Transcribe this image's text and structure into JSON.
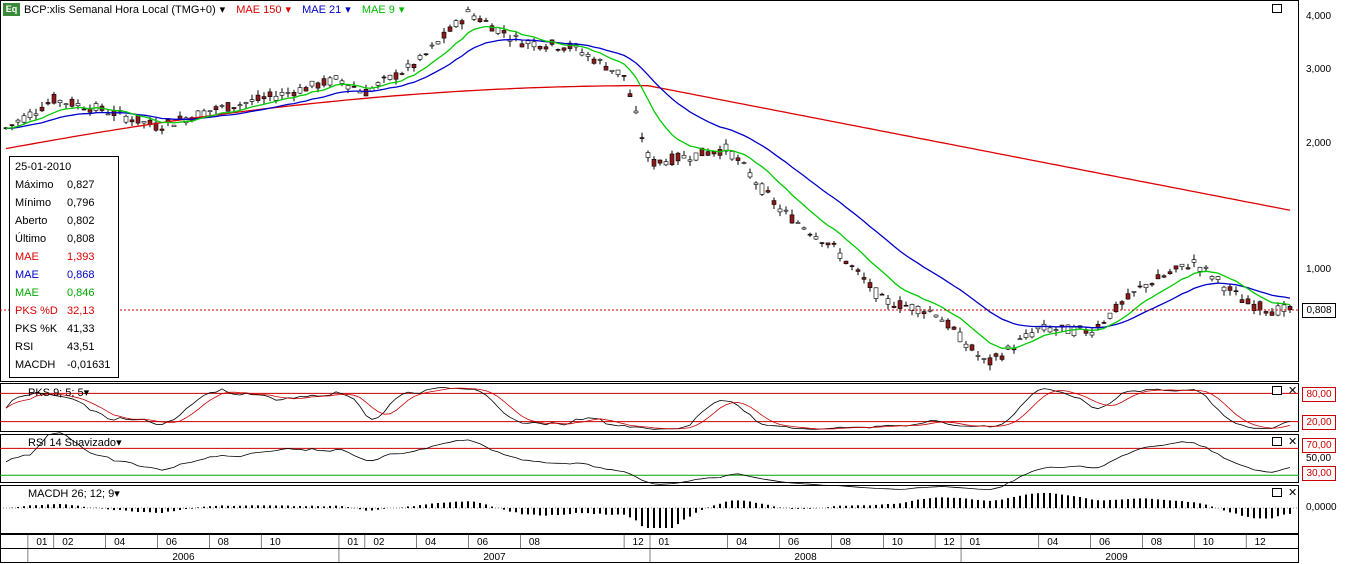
{
  "header": {
    "logo": "Eq",
    "symbol": "BCP:xlis Semanal Hora Local (TMG+0)",
    "mae150": "MAE 150",
    "mae21": "MAE 21",
    "mae9": "MAE 9",
    "dropdown_glyph": "▾"
  },
  "infobox": {
    "date": "25-01-2010",
    "rows": [
      {
        "label": "Máximo",
        "value": "0,827",
        "color": "#000000"
      },
      {
        "label": "Mínimo",
        "value": "0,796",
        "color": "#000000"
      },
      {
        "label": "Aberto",
        "value": "0,802",
        "color": "#000000"
      },
      {
        "label": "Último",
        "value": "0,808",
        "color": "#000000"
      },
      {
        "label": "MAE",
        "value": "1,393",
        "color": "#dd0000"
      },
      {
        "label": "MAE",
        "value": "0,868",
        "color": "#0000cc"
      },
      {
        "label": "MAE",
        "value": "0,846",
        "color": "#00aa00"
      },
      {
        "label": "PKS %D",
        "value": "32,13",
        "color": "#dd0000"
      },
      {
        "label": "PKS %K",
        "value": "41,33",
        "color": "#000000"
      },
      {
        "label": "RSI",
        "value": "43,51",
        "color": "#000000"
      },
      {
        "label": "MACDH",
        "value": "-0,01631",
        "color": "#000000"
      }
    ]
  },
  "panels": {
    "pks_title": "PKS 9; 5; 5",
    "rsi_title": "RSI 14 Suavizado",
    "macd_title": "MACDH 26; 12; 9"
  },
  "axis": {
    "price_labels": [
      "4,000",
      "3,000",
      "2,000",
      "1,000"
    ],
    "last_price": "0,808",
    "pks_levels": [
      "80,00",
      "20,00"
    ],
    "rsi_levels": [
      "70,00",
      "50,00",
      "30,00"
    ],
    "macd_zero": "0,0000",
    "months": [
      "01",
      "02",
      "04",
      "06",
      "08",
      "10",
      "01",
      "02",
      "04",
      "06",
      "08",
      "12",
      "01",
      "04",
      "06",
      "08",
      "10",
      "12",
      "01",
      "04",
      "06",
      "08",
      "10",
      "12"
    ],
    "years": [
      "2006",
      "2007",
      "2008",
      "2009"
    ]
  },
  "chart_data": {
    "type": "candlestick",
    "title": "BCP:xlis Semanal Hora Local (TMG+0)",
    "scale": "log",
    "ylim": [
      0.5,
      4.2
    ],
    "last": 0.808,
    "x_range": [
      "2005-12",
      "2010-01"
    ],
    "approx_close_path": [
      {
        "date": "2005-12",
        "close": 2.15
      },
      {
        "date": "2006-02",
        "close": 2.55
      },
      {
        "date": "2006-04",
        "close": 2.4
      },
      {
        "date": "2006-06",
        "close": 2.2
      },
      {
        "date": "2006-08",
        "close": 2.4
      },
      {
        "date": "2006-10",
        "close": 2.55
      },
      {
        "date": "2007-01",
        "close": 2.85
      },
      {
        "date": "2007-02",
        "close": 2.65
      },
      {
        "date": "2007-04",
        "close": 3.1
      },
      {
        "date": "2007-06",
        "close": 4.1
      },
      {
        "date": "2007-08",
        "close": 3.5
      },
      {
        "date": "2007-10",
        "close": 3.4
      },
      {
        "date": "2007-12",
        "close": 2.9
      },
      {
        "date": "2008-01",
        "close": 1.8
      },
      {
        "date": "2008-04",
        "close": 1.95
      },
      {
        "date": "2008-06",
        "close": 1.4
      },
      {
        "date": "2008-08",
        "close": 1.15
      },
      {
        "date": "2008-10",
        "close": 0.85
      },
      {
        "date": "2008-12",
        "close": 0.8
      },
      {
        "date": "2009-02",
        "close": 0.6
      },
      {
        "date": "2009-04",
        "close": 0.73
      },
      {
        "date": "2009-06",
        "close": 0.72
      },
      {
        "date": "2009-08",
        "close": 0.92
      },
      {
        "date": "2009-10",
        "close": 1.05
      },
      {
        "date": "2009-12",
        "close": 0.84
      },
      {
        "date": "2010-01",
        "close": 0.808
      }
    ],
    "series": [
      {
        "name": "MAE 150",
        "color": "#dd0000",
        "last": 1.393
      },
      {
        "name": "MAE 21",
        "color": "#0000cc",
        "last": 0.868
      },
      {
        "name": "MAE 9",
        "color": "#00cc00",
        "last": 0.846
      }
    ],
    "indicators": {
      "pks": {
        "name": "PKS 9; 5; 5",
        "levels": [
          80,
          20
        ],
        "pct_d": 32.13,
        "pct_k": 41.33
      },
      "rsi": {
        "name": "RSI 14 Suavizado",
        "levels": [
          70,
          50,
          30
        ],
        "last": 43.51
      },
      "macdh": {
        "name": "MACDH 26; 12; 9",
        "zero": 0,
        "last": -0.01631
      }
    }
  },
  "colors": {
    "up": "#ffffff",
    "down": "#8b1a1a",
    "grid": "#000000",
    "refline": "#cc0000"
  }
}
